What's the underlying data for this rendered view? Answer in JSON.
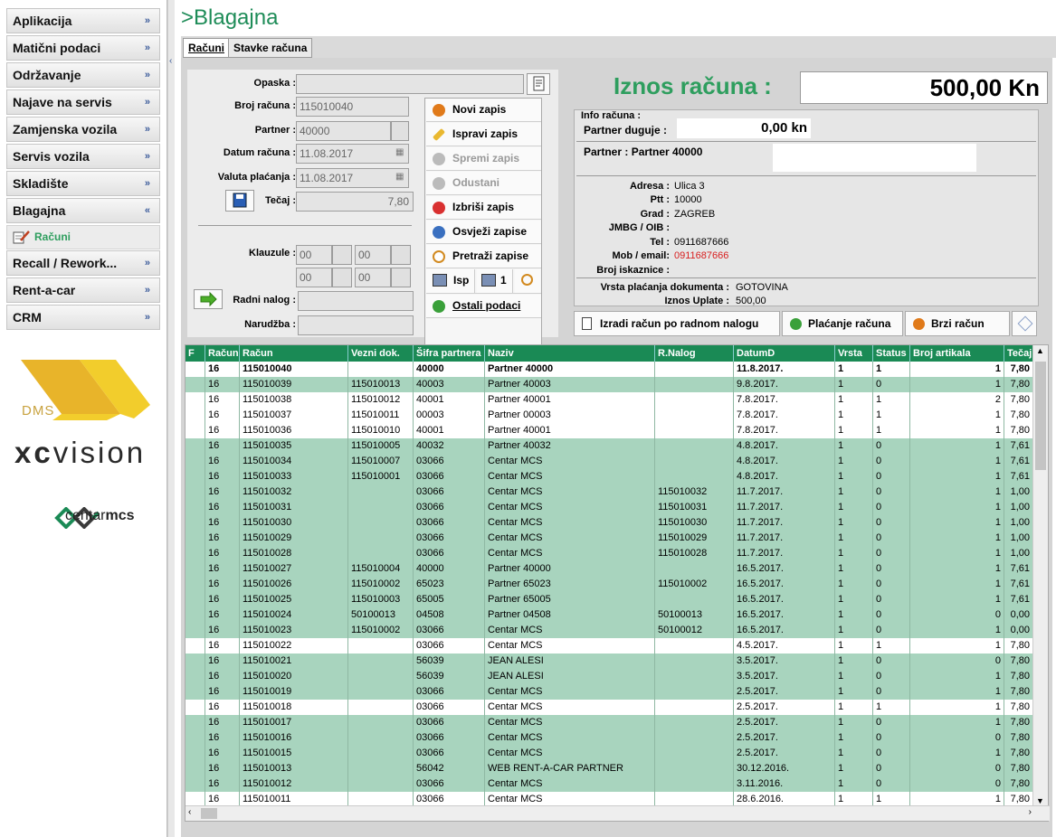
{
  "sidebar": {
    "items": [
      "Aplikacija",
      "Matični podaci",
      "Održavanje",
      "Najave na servis",
      "Zamjenska vozila",
      "Servis vozila",
      "Skladište",
      "Blagajna",
      "Recall / Rework...",
      "Rent-a-car",
      "CRM"
    ],
    "sub_item": "Računi"
  },
  "logos": {
    "dms": "DMS",
    "xc_bold": "xc",
    "xc_light": "vision",
    "cm_light": "centar",
    "cm_bold": "mcs"
  },
  "page": {
    "title": ">Blagajna"
  },
  "tabs": [
    "Računi",
    "Stavke računa"
  ],
  "form": {
    "labels": {
      "opaska": "Opaska :",
      "broj": "Broj računa :",
      "partner": "Partner :",
      "datum": "Datum računa :",
      "valuta": "Valuta plaćanja :",
      "tecaj": "Tečaj :",
      "klauzule": "Klauzule :",
      "radni": "Radni nalog :",
      "narudzba": "Narudžba :"
    },
    "values": {
      "opaska": "",
      "broj": "115010040",
      "partner": "40000",
      "datum": "11.08.2017",
      "valuta": "11.08.2017",
      "tecaj": "7,80",
      "k1": "00",
      "k2": "00",
      "k3": "00",
      "k4": "00",
      "radni": "",
      "narudzba": ""
    }
  },
  "actions": [
    "Novi zapis",
    "Ispravi zapis",
    "Spremi zapis",
    "Odustani",
    "Izbriši zapis",
    "Osvježi zapise",
    "Pretraži zapise",
    "Ostali podaci"
  ],
  "print": {
    "isp": "Isp",
    "count": "1"
  },
  "iznos": {
    "label": "Iznos računa :",
    "value": "500,00 Kn"
  },
  "info": {
    "title": "Info računa :",
    "duguje_label": "Partner duguje :",
    "duguje_value": "0,00 kn",
    "partner_label": "Partner :",
    "partner_value": "Partner 40000",
    "adresa_label": "Adresa :",
    "adresa": "Ulica 3",
    "ptt_label": "Ptt :",
    "ptt": "10000",
    "grad_label": "Grad :",
    "grad": "ZAGREB",
    "jmbg_label": "JMBG / OIB :",
    "jmbg": "",
    "tel_label": "Tel :",
    "tel": "0911687666",
    "mob_label": "Mob / email:",
    "mob": "0911687666",
    "iskaznica_label": "Broj iskaznice :",
    "iskaznica": "",
    "vrsta_label": "Vrsta plaćanja dokumenta :",
    "vrsta": "GOTOVINA",
    "uplata_label": "Iznos Uplate :",
    "uplata": "500,00"
  },
  "bottom_buttons": [
    "Izradi račun po radnom nalogu",
    "Plaćanje računa",
    "Brzi račun"
  ],
  "grid": {
    "columns": [
      "F",
      "Račun",
      "Račun",
      "Vezni dok.",
      "Šifra partnera",
      "Naziv",
      "R.Nalog",
      "DatumD",
      "Vrsta",
      "Status",
      "Broj artikala",
      "Tečaj"
    ],
    "rows": [
      {
        "s": "sel",
        "c": [
          "",
          "16",
          "115010040",
          "",
          "40000",
          "Partner 40000",
          "",
          "11.8.2017.",
          "1",
          "1",
          "1",
          "7,80"
        ]
      },
      {
        "s": "g",
        "c": [
          "",
          "16",
          "115010039",
          "115010013",
          "40003",
          "Partner 40003",
          "",
          "9.8.2017.",
          "1",
          "0",
          "1",
          "7,80"
        ]
      },
      {
        "s": "w",
        "c": [
          "",
          "16",
          "115010038",
          "115010012",
          "40001",
          "Partner 40001",
          "",
          "7.8.2017.",
          "1",
          "1",
          "2",
          "7,80"
        ]
      },
      {
        "s": "w",
        "c": [
          "",
          "16",
          "115010037",
          "115010011",
          "00003",
          "Partner 00003",
          "",
          "7.8.2017.",
          "1",
          "1",
          "1",
          "7,80"
        ]
      },
      {
        "s": "w",
        "c": [
          "",
          "16",
          "115010036",
          "115010010",
          "40001",
          "Partner 40001",
          "",
          "7.8.2017.",
          "1",
          "1",
          "1",
          "7,80"
        ]
      },
      {
        "s": "g",
        "c": [
          "",
          "16",
          "115010035",
          "115010005",
          "40032",
          "Partner 40032",
          "",
          "4.8.2017.",
          "1",
          "0",
          "1",
          "7,61"
        ]
      },
      {
        "s": "g",
        "c": [
          "",
          "16",
          "115010034",
          "115010007",
          "03066",
          "Centar MCS",
          "",
          "4.8.2017.",
          "1",
          "0",
          "1",
          "7,61"
        ]
      },
      {
        "s": "g",
        "c": [
          "",
          "16",
          "115010033",
          "115010001",
          "03066",
          "Centar MCS",
          "",
          "4.8.2017.",
          "1",
          "0",
          "1",
          "7,61"
        ]
      },
      {
        "s": "g",
        "c": [
          "",
          "16",
          "115010032",
          "",
          "03066",
          "Centar MCS",
          "115010032",
          "11.7.2017.",
          "1",
          "0",
          "1",
          "1,00"
        ]
      },
      {
        "s": "g",
        "c": [
          "",
          "16",
          "115010031",
          "",
          "03066",
          "Centar MCS",
          "115010031",
          "11.7.2017.",
          "1",
          "0",
          "1",
          "1,00"
        ]
      },
      {
        "s": "g",
        "c": [
          "",
          "16",
          "115010030",
          "",
          "03066",
          "Centar MCS",
          "115010030",
          "11.7.2017.",
          "1",
          "0",
          "1",
          "1,00"
        ]
      },
      {
        "s": "g",
        "c": [
          "",
          "16",
          "115010029",
          "",
          "03066",
          "Centar MCS",
          "115010029",
          "11.7.2017.",
          "1",
          "0",
          "1",
          "1,00"
        ]
      },
      {
        "s": "g",
        "c": [
          "",
          "16",
          "115010028",
          "",
          "03066",
          "Centar MCS",
          "115010028",
          "11.7.2017.",
          "1",
          "0",
          "1",
          "1,00"
        ]
      },
      {
        "s": "g",
        "c": [
          "",
          "16",
          "115010027",
          "115010004",
          "40000",
          "Partner 40000",
          "",
          "16.5.2017.",
          "1",
          "0",
          "1",
          "7,61"
        ]
      },
      {
        "s": "g",
        "c": [
          "",
          "16",
          "115010026",
          "115010002",
          "65023",
          "Partner 65023",
          "115010002",
          "16.5.2017.",
          "1",
          "0",
          "1",
          "7,61"
        ]
      },
      {
        "s": "g",
        "c": [
          "",
          "16",
          "115010025",
          "115010003",
          "65005",
          "Partner 65005",
          "",
          "16.5.2017.",
          "1",
          "0",
          "1",
          "7,61"
        ]
      },
      {
        "s": "g",
        "c": [
          "",
          "16",
          "115010024",
          "50100013",
          "04508",
          "Partner 04508",
          "50100013",
          "16.5.2017.",
          "1",
          "0",
          "0",
          "0,00"
        ]
      },
      {
        "s": "g",
        "c": [
          "",
          "16",
          "115010023",
          "115010002",
          "03066",
          "Centar MCS",
          "50100012",
          "16.5.2017.",
          "1",
          "0",
          "1",
          "0,00"
        ]
      },
      {
        "s": "w",
        "c": [
          "",
          "16",
          "115010022",
          "",
          "03066",
          "Centar MCS",
          "",
          "4.5.2017.",
          "1",
          "1",
          "1",
          "7,80"
        ]
      },
      {
        "s": "g",
        "c": [
          "",
          "16",
          "115010021",
          "",
          "56039",
          "JEAN ALESI",
          "",
          "3.5.2017.",
          "1",
          "0",
          "0",
          "7,80"
        ]
      },
      {
        "s": "g",
        "c": [
          "",
          "16",
          "115010020",
          "",
          "56039",
          "JEAN ALESI",
          "",
          "3.5.2017.",
          "1",
          "0",
          "1",
          "7,80"
        ]
      },
      {
        "s": "g",
        "c": [
          "",
          "16",
          "115010019",
          "",
          "03066",
          "Centar MCS",
          "",
          "2.5.2017.",
          "1",
          "0",
          "1",
          "7,80"
        ]
      },
      {
        "s": "w",
        "c": [
          "",
          "16",
          "115010018",
          "",
          "03066",
          "Centar MCS",
          "",
          "2.5.2017.",
          "1",
          "1",
          "1",
          "7,80"
        ]
      },
      {
        "s": "g",
        "c": [
          "",
          "16",
          "115010017",
          "",
          "03066",
          "Centar MCS",
          "",
          "2.5.2017.",
          "1",
          "0",
          "1",
          "7,80"
        ]
      },
      {
        "s": "g",
        "c": [
          "",
          "16",
          "115010016",
          "",
          "03066",
          "Centar MCS",
          "",
          "2.5.2017.",
          "1",
          "0",
          "0",
          "7,80"
        ]
      },
      {
        "s": "g",
        "c": [
          "",
          "16",
          "115010015",
          "",
          "03066",
          "Centar MCS",
          "",
          "2.5.2017.",
          "1",
          "0",
          "1",
          "7,80"
        ]
      },
      {
        "s": "g",
        "c": [
          "",
          "16",
          "115010013",
          "",
          "56042",
          "WEB RENT-A-CAR PARTNER",
          "",
          "30.12.2016.",
          "1",
          "0",
          "0",
          "7,80"
        ]
      },
      {
        "s": "g",
        "c": [
          "",
          "16",
          "115010012",
          "",
          "03066",
          "Centar MCS",
          "",
          "3.11.2016.",
          "1",
          "0",
          "0",
          "7,80"
        ]
      },
      {
        "s": "w",
        "c": [
          "",
          "16",
          "115010011",
          "",
          "03066",
          "Centar MCS",
          "",
          "28.6.2016.",
          "1",
          "1",
          "1",
          "7,80"
        ]
      }
    ]
  },
  "colors": {
    "accent": "#1e8c58",
    "row_green": "#a8d4be",
    "header": "#1a8a55",
    "mob": "#d82020"
  }
}
